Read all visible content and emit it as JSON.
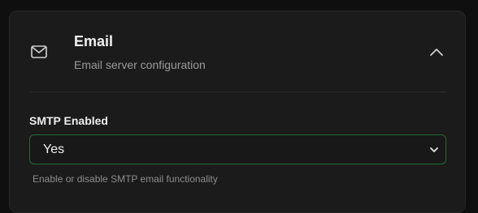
{
  "section": {
    "icon": "mail-icon",
    "title": "Email",
    "subtitle": "Email server configuration",
    "toggle_icon": "chevron-up-icon"
  },
  "field": {
    "label": "SMTP Enabled",
    "value": "Yes",
    "helper": "Enable or disable SMTP email functionality"
  },
  "colors": {
    "background": "#0f0f0f",
    "card": "#1b1b1b",
    "accent_border": "#1f6b3a"
  }
}
